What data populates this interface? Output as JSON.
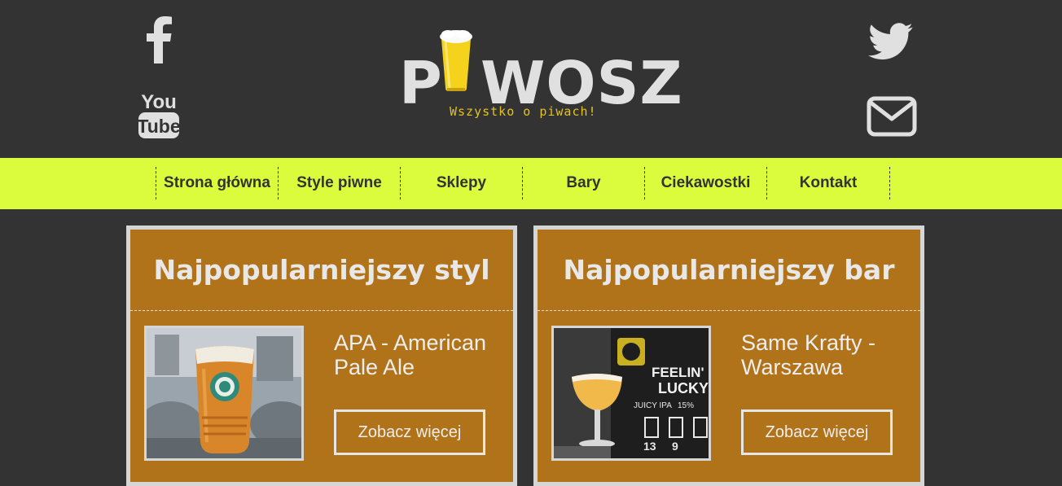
{
  "header": {
    "logo": {
      "letter_before_glass": "P",
      "letters_after_glass": "WOSZ",
      "glass_icon": "beer-glass-icon"
    },
    "tagline": "Wszystko o piwach!",
    "social_left": [
      {
        "icon": "facebook-icon"
      },
      {
        "icon": "youtube-icon",
        "label_top": "You",
        "label_bottom": "Tube"
      }
    ],
    "social_right": [
      {
        "icon": "twitter-icon"
      },
      {
        "icon": "mail-icon"
      }
    ]
  },
  "nav": {
    "items": [
      {
        "label": "Strona główna"
      },
      {
        "label": "Style piwne"
      },
      {
        "label": "Sklepy"
      },
      {
        "label": "Bary"
      },
      {
        "label": "Ciekawostki"
      },
      {
        "label": "Kontakt"
      }
    ]
  },
  "cards": [
    {
      "title": "Najpopularniejszy styl",
      "name": "APA - American Pale Ale",
      "button": "Zobacz więcej"
    },
    {
      "title": "Najpopularniejszy bar",
      "name": "Same Krafty - Warszawa",
      "button": "Zobacz więcej",
      "photo_sign": {
        "line1": "FEELIN'",
        "line2": "LUCKY",
        "line3": "JUICY IPA",
        "abv": "15%",
        "n1": "13",
        "n2": "9"
      }
    }
  ],
  "colors": {
    "background": "#333333",
    "nav_accent": "#dafc3c",
    "card_bg": "#b17319",
    "tagline": "#e3c21f"
  }
}
